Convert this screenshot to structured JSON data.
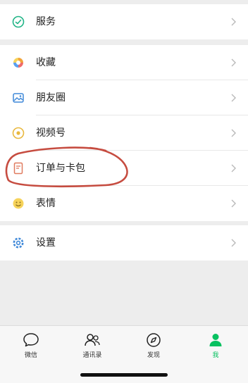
{
  "colors": {
    "background": "#ededed",
    "accent_green": "#07c160",
    "annotation_red": "#c0392b"
  },
  "menu": {
    "group1": [
      {
        "label": "服务",
        "icon": "service-icon"
      }
    ],
    "group2": [
      {
        "label": "收藏",
        "icon": "favorites-icon"
      },
      {
        "label": "朋友圈",
        "icon": "moments-icon"
      },
      {
        "label": "视频号",
        "icon": "channels-icon"
      },
      {
        "label": "订单与卡包",
        "icon": "orders-cards-icon"
      },
      {
        "label": "表情",
        "icon": "stickers-icon"
      }
    ],
    "group3": [
      {
        "label": "设置",
        "icon": "settings-icon"
      }
    ]
  },
  "tabbar": {
    "tabs": [
      {
        "label": "微信",
        "icon": "chats-icon",
        "active": false
      },
      {
        "label": "通讯录",
        "icon": "contacts-icon",
        "active": false
      },
      {
        "label": "发现",
        "icon": "discover-icon",
        "active": false
      },
      {
        "label": "我",
        "icon": "me-icon",
        "active": true
      }
    ]
  }
}
